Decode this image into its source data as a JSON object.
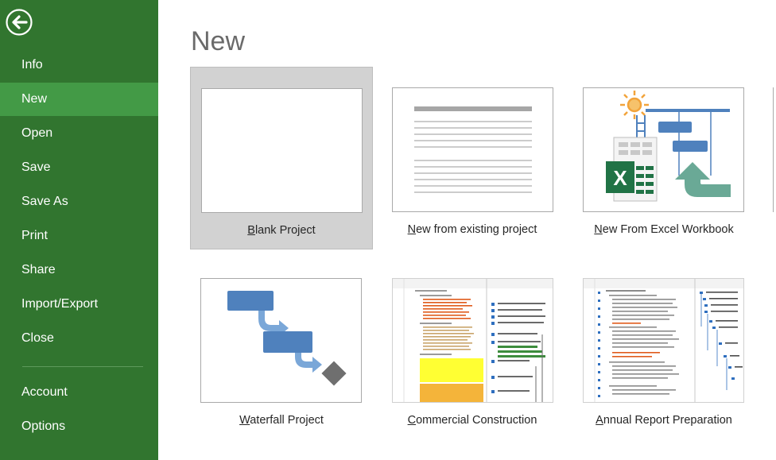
{
  "sidebar": {
    "back_label": "Back",
    "items": [
      {
        "id": "info",
        "label": "Info",
        "active": false
      },
      {
        "id": "new",
        "label": "New",
        "active": true
      },
      {
        "id": "open",
        "label": "Open",
        "active": false
      },
      {
        "id": "save",
        "label": "Save",
        "active": false
      },
      {
        "id": "save-as",
        "label": "Save As",
        "active": false
      },
      {
        "id": "print",
        "label": "Print",
        "active": false
      },
      {
        "id": "share",
        "label": "Share",
        "active": false
      },
      {
        "id": "import-export",
        "label": "Import/Export",
        "active": false
      },
      {
        "id": "close",
        "label": "Close",
        "active": false
      },
      {
        "id": "account",
        "label": "Account",
        "active": false
      },
      {
        "id": "options",
        "label": "Options",
        "active": false
      }
    ]
  },
  "main": {
    "title": "New",
    "templates": [
      {
        "id": "blank-project",
        "first": "B",
        "rest": "lank Project",
        "selected": true
      },
      {
        "id": "new-from-existing",
        "first": "N",
        "rest": "ew from existing project",
        "selected": false
      },
      {
        "id": "new-from-excel",
        "first": "N",
        "rest": "ew From Excel Workbook",
        "selected": false
      },
      {
        "id": "waterfall-project",
        "first": "W",
        "rest": "aterfall Project",
        "selected": false
      },
      {
        "id": "commercial-construction",
        "first": "C",
        "rest": "ommercial Construction",
        "selected": false
      },
      {
        "id": "annual-report",
        "first": "A",
        "rest": "nnual Report Preparation",
        "selected": false
      }
    ]
  },
  "colors": {
    "sidebar_bg": "#31752f",
    "sidebar_active": "#439a46",
    "accent_blue": "#4f81bd",
    "excel_green": "#217346",
    "teal_arrow": "#6aa996",
    "sun_orange": "#f2a33a"
  }
}
